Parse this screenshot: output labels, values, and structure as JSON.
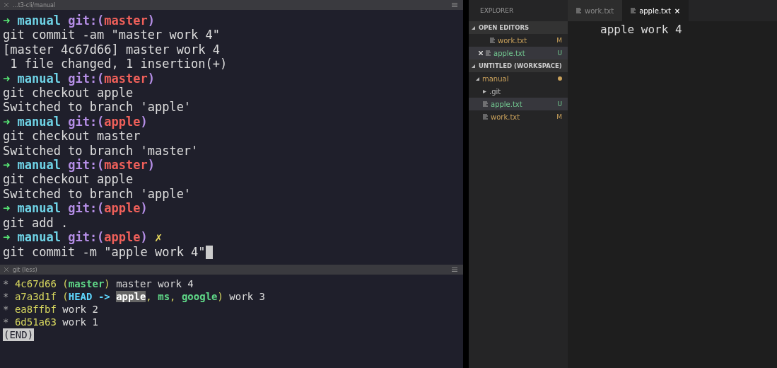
{
  "terminal": {
    "title": "...t3-cli/manual",
    "lines": [
      {
        "kind": "prompt",
        "arrow": "➜",
        "dir": "manual",
        "git": "git:(",
        "branch": "master",
        "close": ")"
      },
      {
        "kind": "output",
        "text": "git commit -am \"master work 4\""
      },
      {
        "kind": "output",
        "text": "[master 4c67d66] master work 4"
      },
      {
        "kind": "output",
        "text": " 1 file changed, 1 insertion(+)"
      },
      {
        "kind": "prompt",
        "arrow": "➜",
        "dir": "manual",
        "git": "git:(",
        "branch": "master",
        "close": ")"
      },
      {
        "kind": "output",
        "text": "git checkout apple"
      },
      {
        "kind": "output",
        "text": "Switched to branch 'apple'"
      },
      {
        "kind": "prompt",
        "arrow": "➜",
        "dir": "manual",
        "git": "git:(",
        "branch": "apple",
        "close": ")"
      },
      {
        "kind": "output",
        "text": "git checkout master"
      },
      {
        "kind": "output",
        "text": "Switched to branch 'master'"
      },
      {
        "kind": "prompt",
        "arrow": "➜",
        "dir": "manual",
        "git": "git:(",
        "branch": "master",
        "close": ")"
      },
      {
        "kind": "output",
        "text": "git checkout apple"
      },
      {
        "kind": "output",
        "text": "Switched to branch 'apple'"
      },
      {
        "kind": "prompt",
        "arrow": "➜",
        "dir": "manual",
        "git": "git:(",
        "branch": "apple",
        "close": ")"
      },
      {
        "kind": "output",
        "text": "git add ."
      },
      {
        "kind": "prompt",
        "arrow": "➜",
        "dir": "manual",
        "git": "git:(",
        "branch": "apple",
        "close": ")",
        "dirty": "✗"
      },
      {
        "kind": "input",
        "text": "git commit -m \"apple work 4\""
      }
    ]
  },
  "pager": {
    "title": "git (less)",
    "commits": [
      {
        "star": "*",
        "hash": "4c67d66",
        "open": " (",
        "refs": [
          {
            "kind": "branch",
            "name": "master"
          }
        ],
        "close": ")",
        "message": " master work 4"
      },
      {
        "star": "*",
        "hash": "a7a3d1f",
        "open": " (",
        "refs": [
          {
            "kind": "head",
            "name": "HEAD -> "
          },
          {
            "kind": "current",
            "name": "apple"
          },
          {
            "kind": "sep",
            "name": ", "
          },
          {
            "kind": "branch",
            "name": "ms"
          },
          {
            "kind": "sep",
            "name": ", "
          },
          {
            "kind": "branch",
            "name": "google"
          }
        ],
        "close": ")",
        "message": " work 3"
      },
      {
        "star": "*",
        "hash": "ea8ffbf",
        "message": " work 2"
      },
      {
        "star": "*",
        "hash": "6d51a63",
        "message": " work 1"
      }
    ],
    "end": "(END)"
  },
  "explorer": {
    "title": "EXPLORER",
    "sections": [
      {
        "title": "OPEN EDITORS",
        "expanded": true,
        "items": [
          {
            "kind": "file",
            "name": "work.txt",
            "status": "M",
            "color": "#c9a15b",
            "closable": false,
            "selected": false
          },
          {
            "kind": "file",
            "name": "apple.txt",
            "status": "U",
            "color": "#73c991",
            "closable": true,
            "selected": true
          }
        ]
      },
      {
        "title": "UNTITLED (WORKSPACE)",
        "expanded": true,
        "items": [
          {
            "kind": "folder",
            "name": "manual",
            "expanded": true,
            "modified": true,
            "color": "#c9a15b",
            "children": [
              {
                "kind": "folder",
                "name": ".git",
                "expanded": false,
                "color": "#bbbbbb"
              },
              {
                "kind": "file",
                "name": "apple.txt",
                "status": "U",
                "color": "#73c991",
                "selected": true
              },
              {
                "kind": "file",
                "name": "work.txt",
                "status": "M",
                "color": "#c9a15b",
                "selected": false
              }
            ]
          }
        ]
      }
    ]
  },
  "editor": {
    "tabs": [
      {
        "label": "work.txt",
        "selected": false
      },
      {
        "label": "apple.txt",
        "selected": true,
        "close": "×"
      }
    ],
    "lines": [
      "apple work 4"
    ]
  }
}
